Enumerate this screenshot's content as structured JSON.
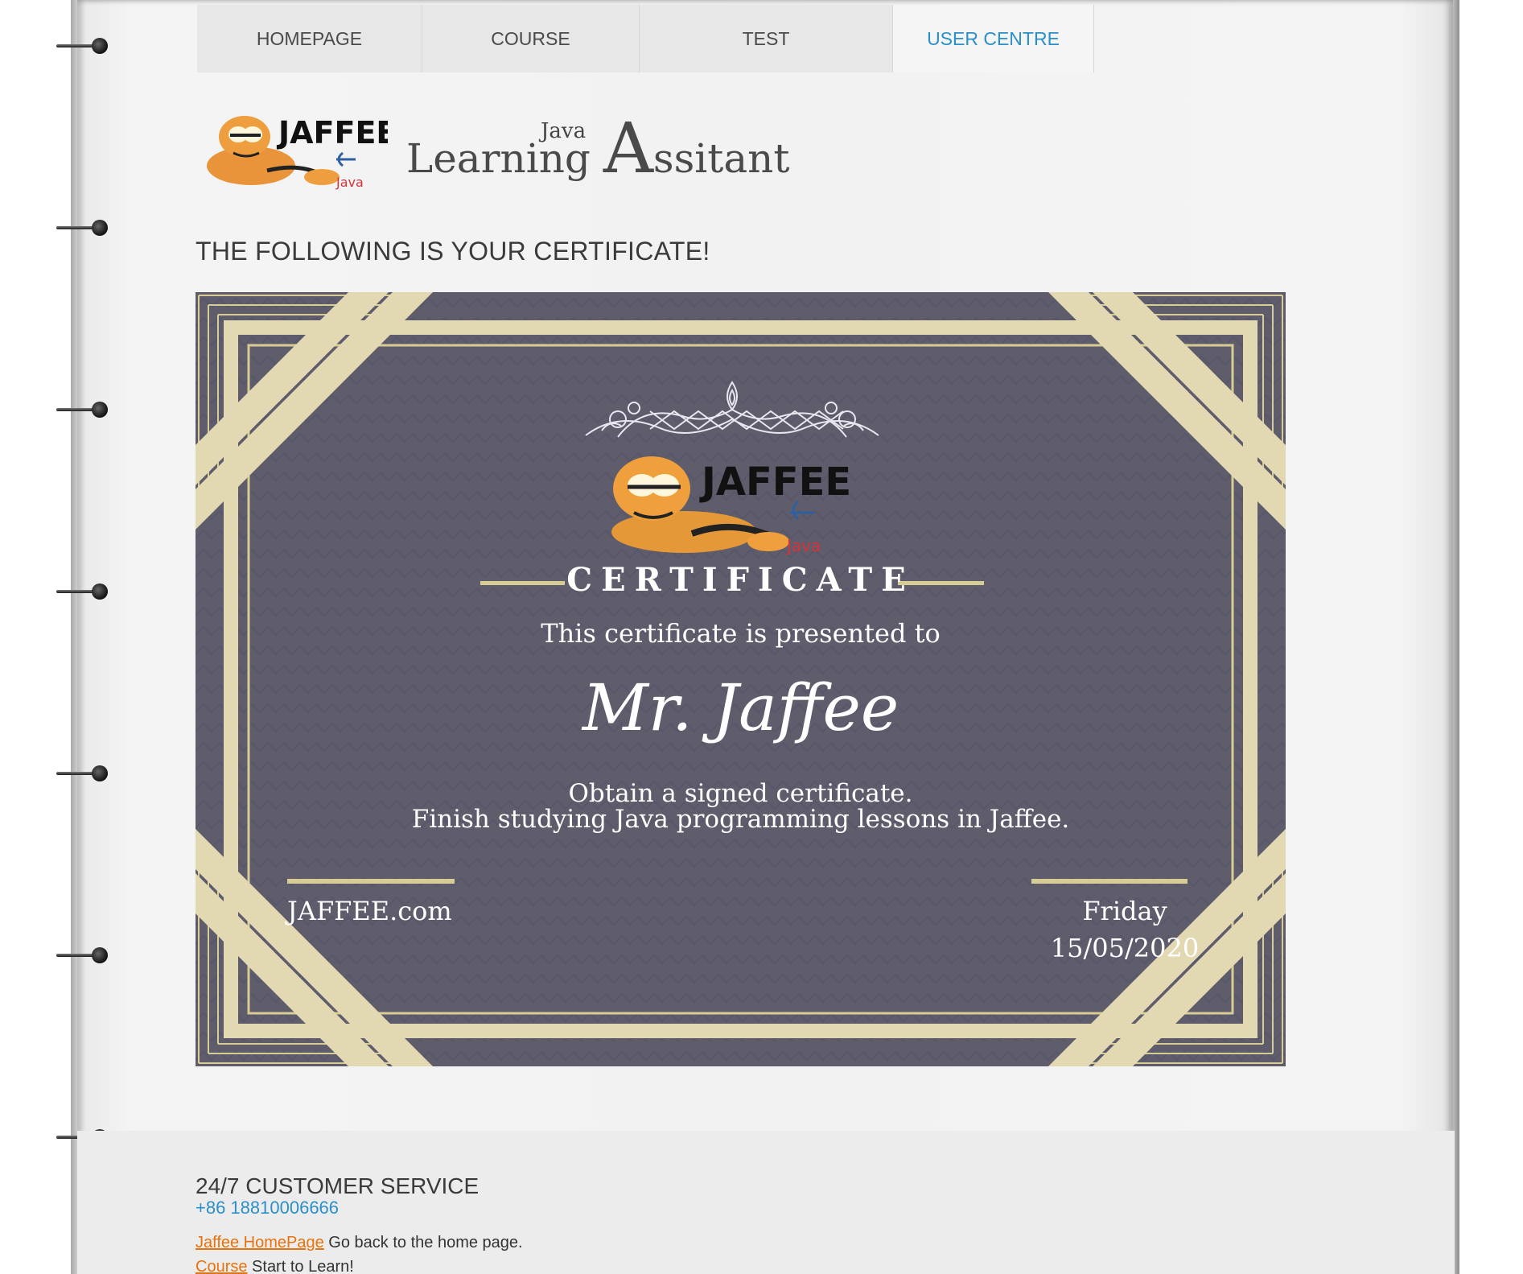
{
  "nav": {
    "items": [
      {
        "label": "HOMEPAGE"
      },
      {
        "label": "COURSE"
      },
      {
        "label": "TEST"
      },
      {
        "label": "USER CENTRE",
        "active": true
      }
    ]
  },
  "logo": {
    "text": "JAFFEE",
    "sub": "Java"
  },
  "brand": {
    "small": "Java",
    "main_before": "Learning ",
    "big_letter": "A",
    "main_after": "ssitant"
  },
  "heading": "THE FOLLOWING IS YOUR CERTIFICATE!",
  "certificate": {
    "logo_text": "JAFFEE",
    "logo_sub": "Java",
    "title": "CERTIFICATE",
    "presented": "This certificate is presented to",
    "name": "Mr. Jaffee",
    "line1": "Obtain a signed certificate.",
    "line2": "Finish studying Java programming lessons in Jaffee.",
    "site": "JAFFEE.com",
    "day": "Friday",
    "date": "15/05/2020"
  },
  "footer": {
    "service_title": "24/7 CUSTOMER SERVICE",
    "phone": "+86 18810006666",
    "links": [
      {
        "link": "Jaffee HomePage",
        "text": " Go back to the home page."
      },
      {
        "link": "Course",
        "text": " Start to Learn!"
      }
    ]
  },
  "colors": {
    "accent": "#2b8fc9",
    "link": "#e8720c",
    "cert_bg": "#5f5d6c",
    "cert_gold": "#d8cc95",
    "cert_band": "#e2d9b3"
  }
}
